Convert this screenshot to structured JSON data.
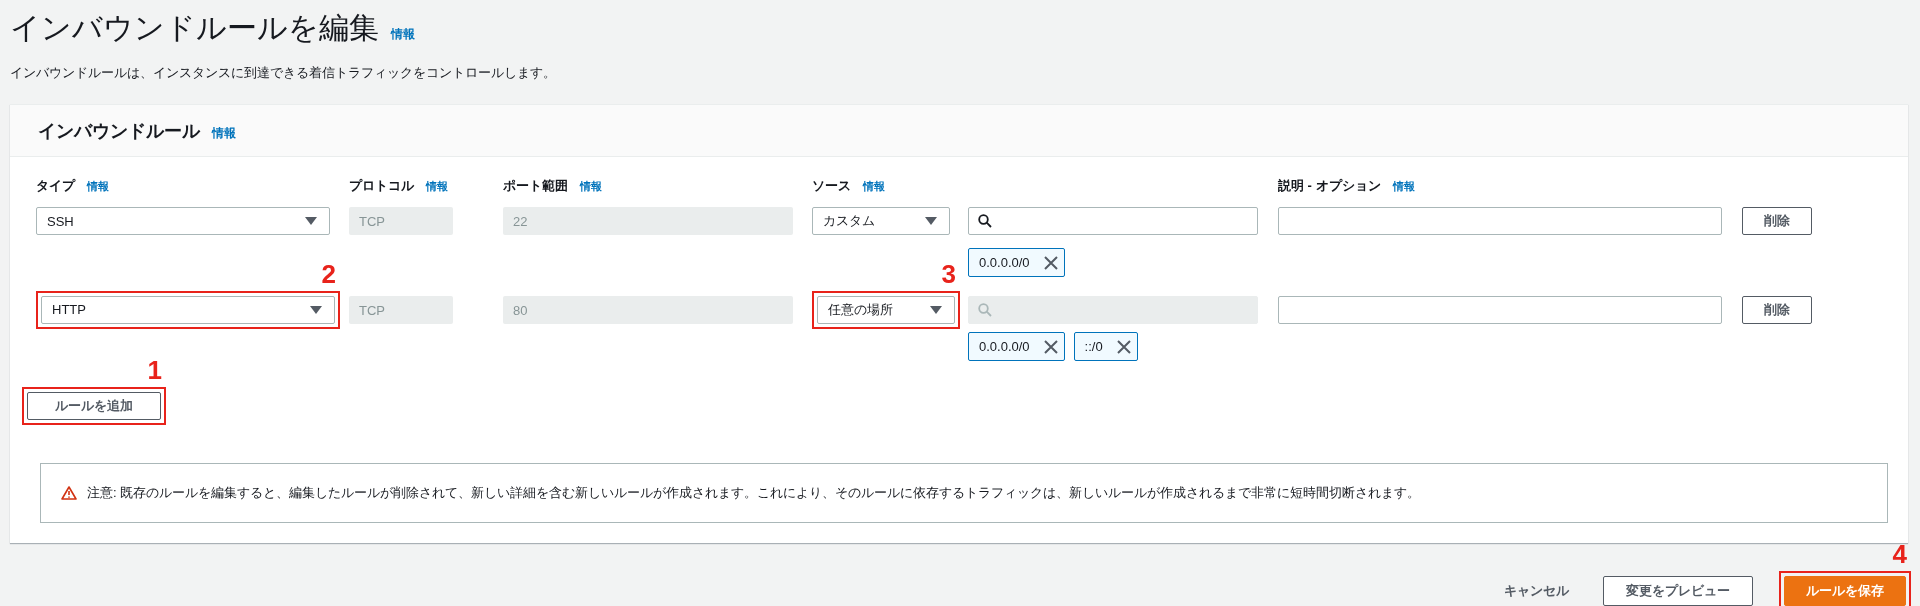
{
  "page": {
    "title": "インバウンドルールを編集",
    "title_info": "情報",
    "description": "インバウンドルールは、インスタンスに到達できる着信トラフィックをコントロールします。"
  },
  "panel": {
    "title": "インバウンドルール",
    "info": "情報"
  },
  "headers": {
    "type": {
      "label": "タイプ",
      "info": "情報"
    },
    "protocol": {
      "label": "プロトコル",
      "info": "情報"
    },
    "port": {
      "label": "ポート範囲",
      "info": "情報"
    },
    "source": {
      "label": "ソース",
      "info": "情報"
    },
    "description": {
      "label": "説明 - オプション",
      "info": "情報"
    }
  },
  "rules": [
    {
      "type": "SSH",
      "protocol": "TCP",
      "port": "22",
      "source": "カスタム",
      "search_disabled": false,
      "cidrs": [
        "0.0.0.0/0"
      ],
      "delete": "削除"
    },
    {
      "type": "HTTP",
      "protocol": "TCP",
      "port": "80",
      "source": "任意の場所",
      "search_disabled": true,
      "cidrs": [
        "0.0.0.0/0",
        "::/0"
      ],
      "delete": "削除",
      "type_annotation": "2",
      "source_annotation": "3"
    }
  ],
  "add_button": {
    "label": "ルールを追加",
    "annotation": "1"
  },
  "warning": "注意: 既存のルールを編集すると、編集したルールが削除されて、新しい詳細を含む新しいルールが作成されます。これにより、そのルールに依存するトラフィックは、新しいルールが作成されるまで非常に短時間切断されます。",
  "footer": [
    {
      "kind": "link",
      "label": "キャンセル"
    },
    {
      "kind": "normal",
      "label": "変更をプレビュー"
    },
    {
      "kind": "primary",
      "label": "ルールを保存",
      "annotation": "4"
    }
  ]
}
